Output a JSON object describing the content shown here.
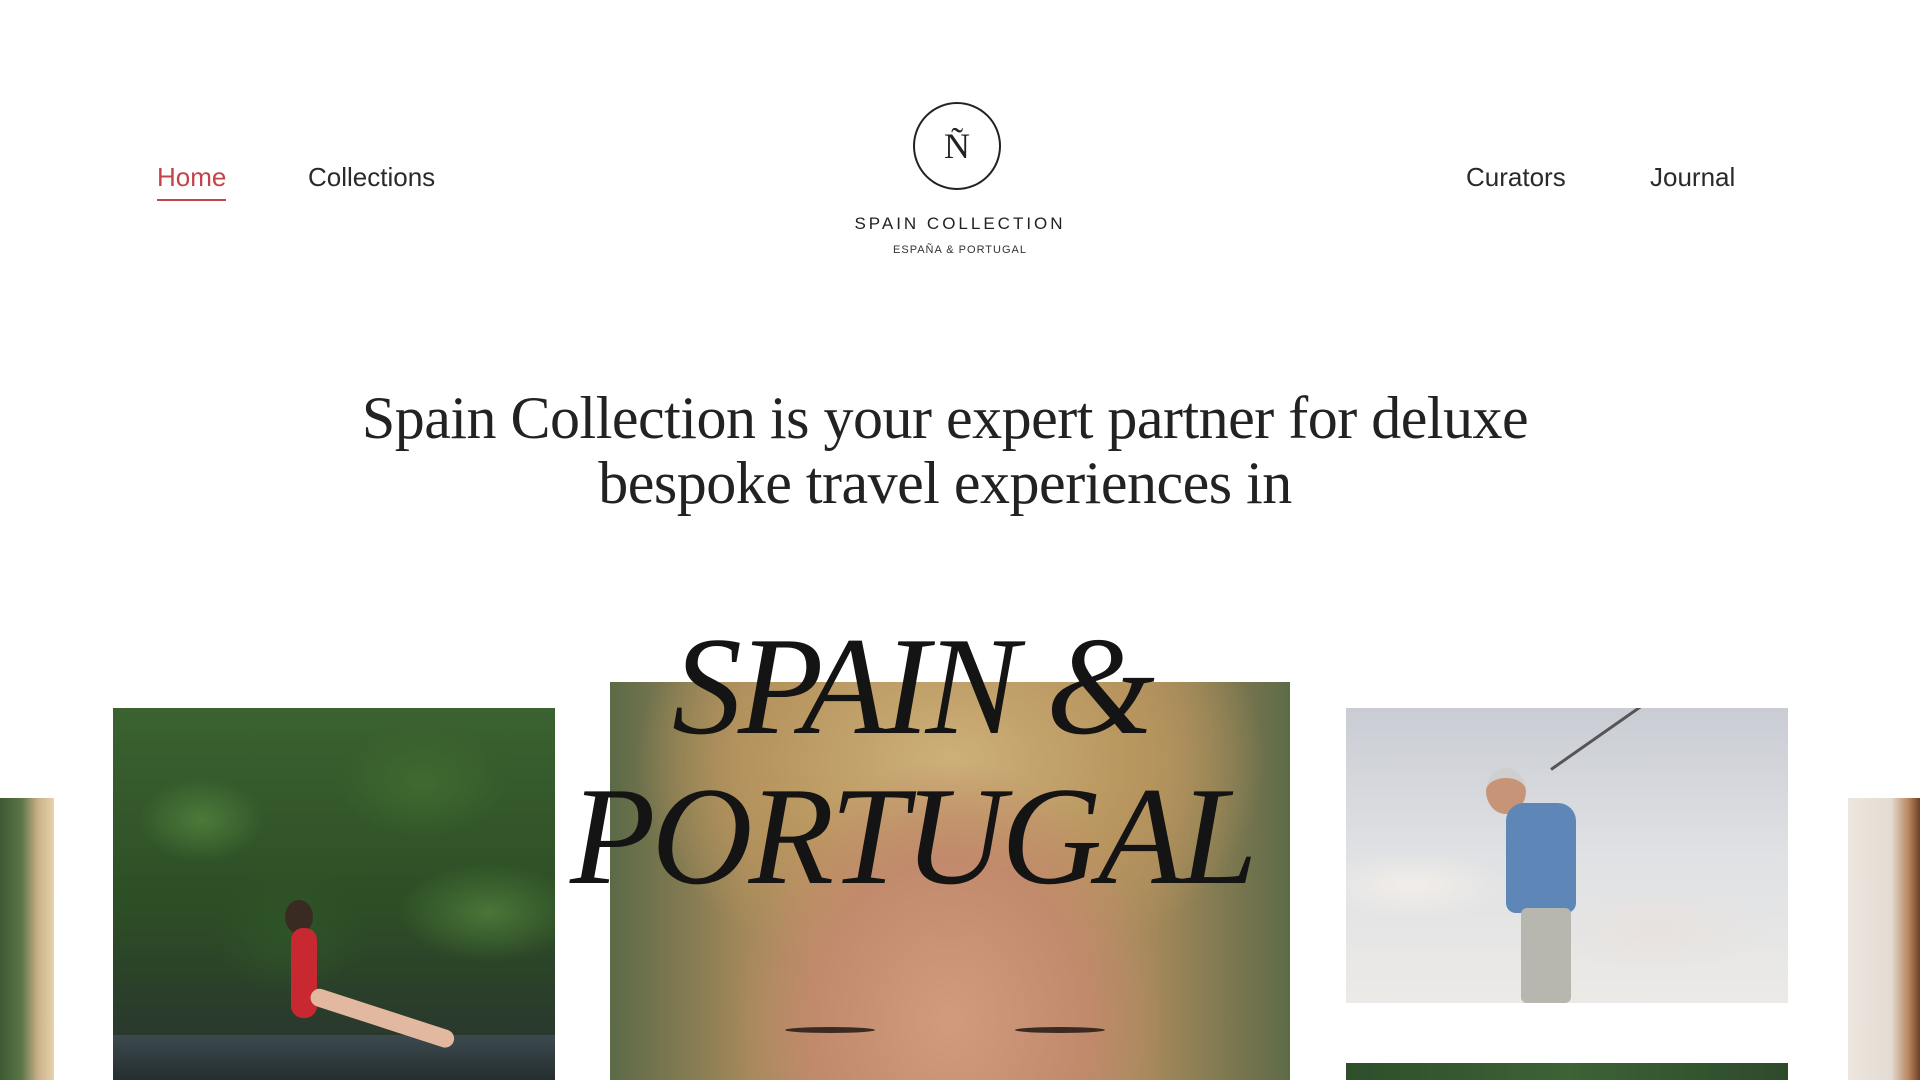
{
  "header": {
    "nav_left": [
      {
        "label": "Home",
        "active": true
      },
      {
        "label": "Collections",
        "active": false
      }
    ],
    "nav_right": [
      {
        "label": "Curators",
        "active": false
      },
      {
        "label": "Journal",
        "active": false
      }
    ],
    "logo": {
      "monogram": "Ñ",
      "name": "SPAIN COLLECTION",
      "tagline": "ESPAÑA & PORTUGAL"
    }
  },
  "intro": {
    "line1": "Spain Collection is your expert partner for deluxe",
    "line2": "bespoke travel experiences in"
  },
  "display": {
    "line1": "Spain &",
    "line2": "Portugal"
  },
  "colors": {
    "accent": "#c4434b",
    "text": "#222222",
    "background": "#ffffff"
  }
}
